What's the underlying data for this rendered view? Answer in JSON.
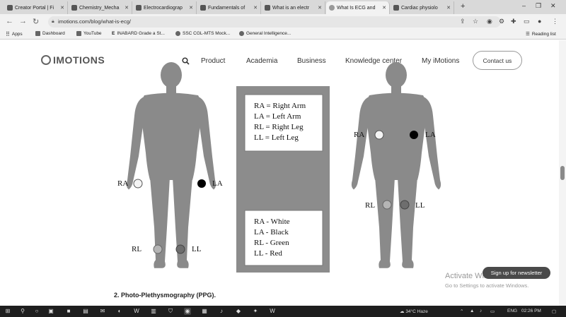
{
  "browser": {
    "tabs": [
      {
        "label": "Creator Portal | Fi"
      },
      {
        "label": "Chemistry_Mecha"
      },
      {
        "label": "Electrocardiograp"
      },
      {
        "label": "Fundamentals of"
      },
      {
        "label": "What is an electr"
      },
      {
        "label": "What Is ECG and"
      },
      {
        "label": "Cardiac physiolo"
      }
    ],
    "new_tab": "+",
    "url": "imotions.com/blog/what-is-ecg/",
    "bookmarks": [
      {
        "label": "Apps"
      },
      {
        "label": "Dashboard"
      },
      {
        "label": "YouTube"
      },
      {
        "label": "INABARD Grade a St..."
      },
      {
        "label": "SSC CGL-MTS Mock..."
      },
      {
        "label": "General Intelligence..."
      }
    ],
    "reading_list": "Reading list"
  },
  "site": {
    "logo_text": "IMOTIONS",
    "nav": [
      {
        "label": "Product"
      },
      {
        "label": "Academia"
      },
      {
        "label": "Business"
      },
      {
        "label": "Knowledge center"
      },
      {
        "label": "My iMotions"
      }
    ],
    "contact_label": "Contact us"
  },
  "figure": {
    "legend_top": [
      "RA = Right Arm",
      "LA = Left Arm",
      "RL = Right Leg",
      "LL = Left Leg"
    ],
    "legend_bottom": [
      "RA - White",
      "LA - Black",
      "RL - Green",
      "LL - Red"
    ],
    "left_labels": {
      "ra": "RA",
      "la": "LA",
      "rl": "RL",
      "ll": "LL"
    },
    "right_labels": {
      "ra": "RA",
      "la": "LA",
      "rl": "RL",
      "ll": "LL"
    }
  },
  "article": {
    "next_heading": "2.  Photo-Plethysmography (PPG)."
  },
  "overlay": {
    "activate_title": "Activate Windows",
    "activate_sub": "Go to Settings to activate Windows.",
    "newsletter_label": "Sign up for newsletter"
  },
  "taskbar": {
    "weather": "34°C  Haze",
    "lang": "ENG",
    "time": "02:26 PM"
  }
}
